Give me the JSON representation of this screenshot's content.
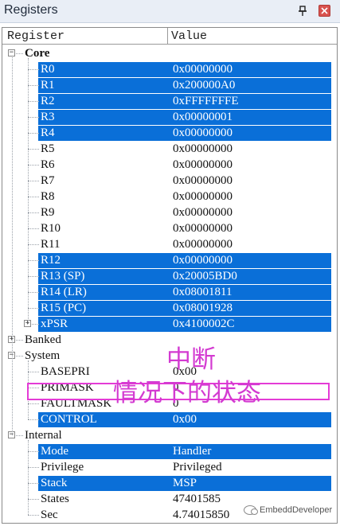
{
  "window": {
    "title": "Registers",
    "pin_glyph": "📌",
    "close_glyph": "✕"
  },
  "header": {
    "col_register": "Register",
    "col_value": "Value"
  },
  "rows": [
    {
      "id": "core",
      "name": "Core",
      "value": "",
      "kind": "group",
      "toggle": "−",
      "selected": false
    },
    {
      "id": "r0",
      "name": "R0",
      "value": "0x00000000",
      "kind": "item",
      "selected": true
    },
    {
      "id": "r1",
      "name": "R1",
      "value": "0x200000A0",
      "kind": "item",
      "selected": true
    },
    {
      "id": "r2",
      "name": "R2",
      "value": "0xFFFFFFFE",
      "kind": "item",
      "selected": true
    },
    {
      "id": "r3",
      "name": "R3",
      "value": "0x00000001",
      "kind": "item",
      "selected": true
    },
    {
      "id": "r4",
      "name": "R4",
      "value": "0x00000000",
      "kind": "item",
      "selected": true
    },
    {
      "id": "r5",
      "name": "R5",
      "value": "0x00000000",
      "kind": "item",
      "selected": false
    },
    {
      "id": "r6",
      "name": "R6",
      "value": "0x00000000",
      "kind": "item",
      "selected": false
    },
    {
      "id": "r7",
      "name": "R7",
      "value": "0x00000000",
      "kind": "item",
      "selected": false
    },
    {
      "id": "r8",
      "name": "R8",
      "value": "0x00000000",
      "kind": "item",
      "selected": false
    },
    {
      "id": "r9",
      "name": "R9",
      "value": "0x00000000",
      "kind": "item",
      "selected": false
    },
    {
      "id": "r10",
      "name": "R10",
      "value": "0x00000000",
      "kind": "item",
      "selected": false
    },
    {
      "id": "r11",
      "name": "R11",
      "value": "0x00000000",
      "kind": "item",
      "selected": false
    },
    {
      "id": "r12",
      "name": "R12",
      "value": "0x00000000",
      "kind": "item",
      "selected": true
    },
    {
      "id": "r13",
      "name": "R13 (SP)",
      "value": "0x20005BD0",
      "kind": "item",
      "selected": true
    },
    {
      "id": "r14",
      "name": "R14 (LR)",
      "value": "0x08001811",
      "kind": "item",
      "selected": true
    },
    {
      "id": "r15",
      "name": "R15 (PC)",
      "value": "0x08001928",
      "kind": "item",
      "selected": true
    },
    {
      "id": "xpsr",
      "name": "xPSR",
      "value": "0x4100002C",
      "kind": "item",
      "toggle": "+",
      "selected": true
    },
    {
      "id": "banked",
      "name": "Banked",
      "value": "",
      "kind": "group",
      "toggle": "+",
      "selected": false
    },
    {
      "id": "system",
      "name": "System",
      "value": "",
      "kind": "group",
      "toggle": "−",
      "selected": false
    },
    {
      "id": "basepri",
      "name": "BASEPRI",
      "value": "0x00",
      "kind": "item",
      "selected": false
    },
    {
      "id": "primask",
      "name": "PRIMASK",
      "value": "0",
      "kind": "item",
      "selected": false
    },
    {
      "id": "faultmask",
      "name": "FAULTMASK",
      "value": "0",
      "kind": "item",
      "selected": false
    },
    {
      "id": "control",
      "name": "CONTROL",
      "value": "0x00",
      "kind": "item",
      "selected": true
    },
    {
      "id": "internal",
      "name": "Internal",
      "value": "",
      "kind": "group",
      "toggle": "−",
      "selected": false
    },
    {
      "id": "mode",
      "name": "Mode",
      "value": "Handler",
      "kind": "item",
      "selected": true
    },
    {
      "id": "privilege",
      "name": "Privilege",
      "value": "Privileged",
      "kind": "item",
      "selected": false
    },
    {
      "id": "stack",
      "name": "Stack",
      "value": "MSP",
      "kind": "item",
      "selected": true
    },
    {
      "id": "states",
      "name": "States",
      "value": "47401585",
      "kind": "item",
      "selected": false
    },
    {
      "id": "sec",
      "name": "Sec",
      "value": "4.74015850",
      "kind": "item",
      "selected": false
    }
  ],
  "annotation": {
    "line1": "中断",
    "line2": "情况下的状态",
    "color": "#d33ad1"
  },
  "watermark": {
    "text": "EmbeddDeveloper"
  },
  "colors": {
    "selection": "#0a6fd8",
    "highlight_border": "#e43bd6"
  }
}
